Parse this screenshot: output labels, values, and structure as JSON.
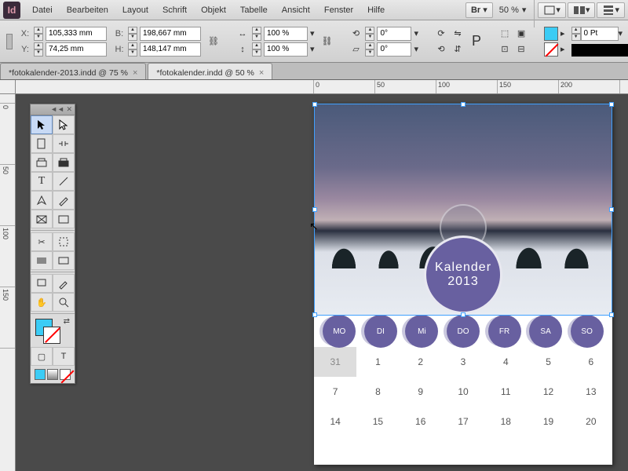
{
  "app": {
    "brand": "Id"
  },
  "menu": [
    "Datei",
    "Bearbeiten",
    "Layout",
    "Schrift",
    "Objekt",
    "Tabelle",
    "Ansicht",
    "Fenster",
    "Hilfe"
  ],
  "header_right": {
    "bridge": "Br",
    "zoom": "50 %"
  },
  "control": {
    "x": "105,333 mm",
    "y": "74,25 mm",
    "w": "198,667 mm",
    "h": "148,147 mm",
    "scale_x": "100 %",
    "scale_y": "100 %",
    "rotate": "0°",
    "shear": "0°",
    "stroke_weight": "0 Pt"
  },
  "tabs": [
    {
      "label": "*fotokalender-2013.indd @ 75 %",
      "active": false
    },
    {
      "label": "*fotokalender.indd @ 50 %",
      "active": true
    }
  ],
  "ruler_h": [
    "0",
    "50",
    "100",
    "150",
    "200"
  ],
  "ruler_v": [
    "0",
    "50",
    "100",
    "150"
  ],
  "toolbox_head": "◄◄  ✕",
  "calendar": {
    "badge_line1": "Kalender",
    "badge_line2": "2013",
    "days": [
      "MO",
      "DI",
      "Mi",
      "DO",
      "FR",
      "SA",
      "SO"
    ],
    "rows": [
      [
        "31",
        "1",
        "2",
        "3",
        "4",
        "5",
        "6"
      ],
      [
        "7",
        "8",
        "9",
        "10",
        "11",
        "12",
        "13"
      ],
      [
        "14",
        "15",
        "16",
        "17",
        "18",
        "19",
        "20"
      ]
    ]
  }
}
